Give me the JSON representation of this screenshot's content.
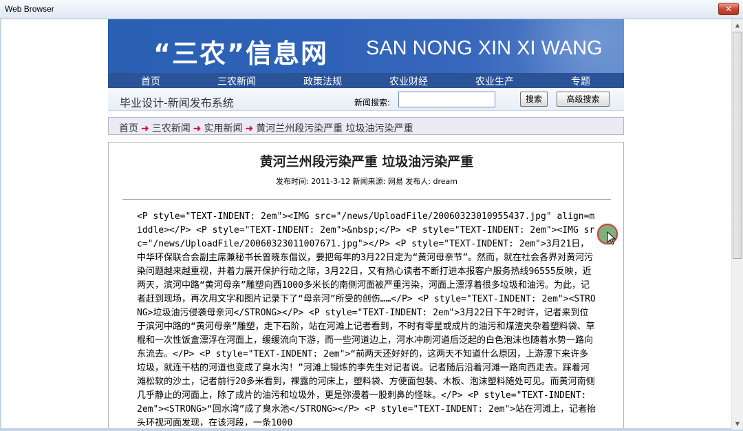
{
  "window": {
    "title": "Web Browser",
    "close_glyph": "✕"
  },
  "site": {
    "banner_cn": "“三农”信息网",
    "banner_en": "SAN NONG XIN XI WANG",
    "nav": [
      "首页",
      "三农新闻",
      "政策法规",
      "农业财经",
      "农业生产",
      "专题"
    ],
    "system_name": "毕业设计-新闻发布系统",
    "search_label": "新闻搜索:",
    "search_value": "",
    "search_button": "搜索",
    "advanced_button": "高级搜索"
  },
  "breadcrumb": [
    "首页",
    "三农新闻",
    "实用新闻",
    "黄河兰州段污染严重 垃圾油污染严重"
  ],
  "article": {
    "title": "黄河兰州段污染严重  垃圾油污染严重",
    "meta": "发布时间: 2011-3-12 新闻来源: 网易 发布人: dream",
    "body": "<P style=\"TEXT-INDENT: 2em\"><IMG src=\"/news/UploadFile/20060323010955437.jpg\" align=middle></P> <P style=\"TEXT-INDENT: 2em\">&nbsp;</P> <P style=\"TEXT-INDENT: 2em\"><IMG src=\"/news/UploadFile/20060323011007671.jpg\"></P> <P style=\"TEXT-INDENT: 2em\">3月21日，中华环保联合会副主席兼秘书长曾晓东倡议，要把每年的3月22日定为“黄河母亲节”。然而，就在社会各界对黄河污染问题越来越重视，并着力展开保护行动之际，3月22日，又有热心读者不断打进本报客户服务热线96555反映，近两天，滨河中路“黄河母亲”雕塑向西1000多米长的南侧河面被严重污染，河面上漂浮着很多垃圾和油污。为此，记者赶到现场，再次用文字和图片记录下了“母亲河”所受的创伤……</P> <P style=\"TEXT-INDENT: 2em\"><STRONG>垃圾油污侵袭母亲河</STRONG></P> <P style=\"TEXT-INDENT: 2em\">3月22日下午2时许，记者来到位于滨河中路的“黄河母亲”雕塑，走下石阶，站在河滩上记者看到，不时有零星或成片的油污和煤渣夹杂着塑料袋、草棍和一次性饭盒漂浮在河面上，缓缓流向下游，而一些河道边上，河水冲刷河道后泛起的白色泡沫也随着水势一路向东流去。</P> <P style=\"TEXT-INDENT: 2em\">“前两天还好好的，这两天不知道什么原因，上游漂下来许多垃圾，就连干枯的河道也变成了臭水沟！”河滩上锻炼的李先生对记者说。记者随后沿着河滩一路向西走去。踩着河滩松软的沙土，记者前行20多米看到，裸露的河床上，塑料袋、方便面包装、木板、泡沫塑料随处可见。而黄河南侧几乎静止的河面上，除了成片的油污和垃圾外，更是弥漫着一股刺鼻的怪味。</P> <P style=\"TEXT-INDENT: 2em\"><STRONG>“回水湾”成了臭水池</STRONG></P> <P style=\"TEXT-INDENT: 2em\">站在河滩上，记者抬头环视河面发现，在该河段，一条1000"
  }
}
